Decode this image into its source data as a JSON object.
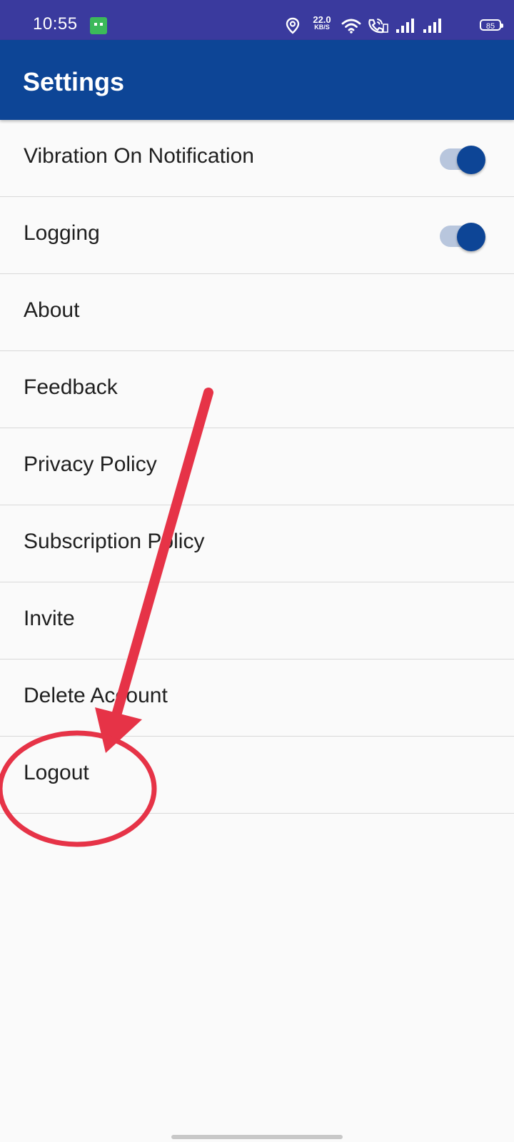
{
  "status_bar": {
    "time": "10:55",
    "net_speed_value": "22.0",
    "net_speed_unit": "KB/S",
    "battery_level": "85",
    "icons": [
      "app-notification-icon",
      "location-icon",
      "wifi-icon",
      "volte-call-icon",
      "signal-icon",
      "signal-icon",
      "battery-icon"
    ]
  },
  "app_bar": {
    "title": "Settings"
  },
  "settings": {
    "items": [
      {
        "label": "Vibration On Notification",
        "toggle": true
      },
      {
        "label": "Logging",
        "toggle": true
      },
      {
        "label": "About"
      },
      {
        "label": "Feedback"
      },
      {
        "label": "Privacy Policy"
      },
      {
        "label": "Subscription Policy"
      },
      {
        "label": "Invite"
      },
      {
        "label": "Delete Account"
      },
      {
        "label": "Logout"
      }
    ]
  },
  "colors": {
    "status_bar": "#3a3a9e",
    "app_bar": "#0d4596",
    "toggle_thumb": "#0d4596",
    "toggle_track": "#b8c6dd",
    "annotation": "#e63347",
    "background": "#fafafa"
  },
  "annotation": {
    "arrow": "red-arrow",
    "circle": "red-circle",
    "target": "Logout"
  }
}
